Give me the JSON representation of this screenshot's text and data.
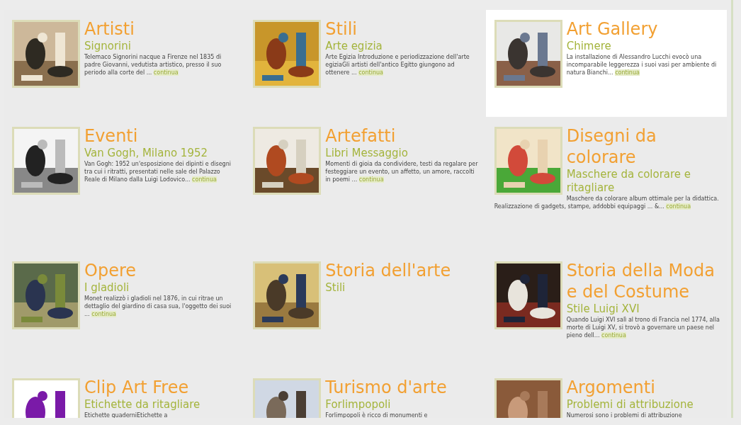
{
  "cards": [
    {
      "title": "Artisti",
      "subtitle": "Signorini",
      "description": "Telemaco Signorini nacque a Firenze nel 1835 di padre Giovanni, vedutista artistico, presso il suo periodo alla corte del ...",
      "link": "continua",
      "highlighted": false
    },
    {
      "title": "Stili",
      "subtitle": "Arte egizia",
      "description": "Arte Egizia Introduzione e periodizzazione dell'arte egiziaGli artisti dell'antico Egitto giungono ad ottenere ...",
      "link": "continua",
      "highlighted": false
    },
    {
      "title": "Art Gallery",
      "subtitle": "Chimere",
      "description": "La installazione di Alessandro Lucchi evocò una incomparabile leggerezza i suoi vasi per ambiente di natura Bianchi...",
      "link": "continua",
      "highlighted": true
    },
    {
      "title": "Eventi",
      "subtitle": "Van Gogh, Milano 1952",
      "description": "Van Gogh: 1952 un'esposizione dei dipinti e disegni tra cui i ritratti, presentati nelle sale del Palazzo Reale di Milano dalla Luigi Lodovico...",
      "link": "continua",
      "highlighted": false
    },
    {
      "title": "Artefatti",
      "subtitle": "Libri Messaggio",
      "description": "Momenti di gioia da condividere, testi da regalare per festeggiare un evento, un affetto, un amore, raccolti in poemi ...",
      "link": "continua",
      "highlighted": false
    },
    {
      "title": "Disegni da colorare",
      "subtitle": "Maschere da colorare e ritagliare",
      "description": "Maschere da colorare album ottimale per la didattica. Realizzazione di gadgets, stampe, addobbi equipaggi ... &...",
      "link": "continua",
      "highlighted": false
    },
    {
      "title": "Opere",
      "subtitle": "I gladioli",
      "description": "Monet realizzò i gladioli nel 1876, in cui ritrae un dettaglio del giardino di casa sua, l'oggetto dei suoi ...",
      "link": "continua",
      "highlighted": false
    },
    {
      "title": "Storia dell'arte",
      "subtitle": "Stili",
      "highlighted": false
    },
    {
      "title": "Storia della Moda e del Costume",
      "subtitle": "Stile Luigi XVI",
      "description": "Quando Luigi XVI salì al trono di Francia nel 1774, alla morte di Luigi XV, si trovò a governare un paese nel pieno dell...",
      "link": "continua",
      "highlighted": false
    },
    {
      "title": "Clip Art Free",
      "subtitle": "Etichette da ritagliare",
      "description": "Etichette quaderniEtichette a",
      "highlighted": false
    },
    {
      "title": "Turismo d'arte",
      "subtitle": "Forlimpopoli",
      "description": "Forlimpopoli è ricco di monumenti e",
      "highlighted": false
    },
    {
      "title": "Argomenti",
      "subtitle": "Problemi di attribuzione",
      "description": "Numerosi sono i problemi di attribuzione",
      "highlighted": false
    }
  ]
}
